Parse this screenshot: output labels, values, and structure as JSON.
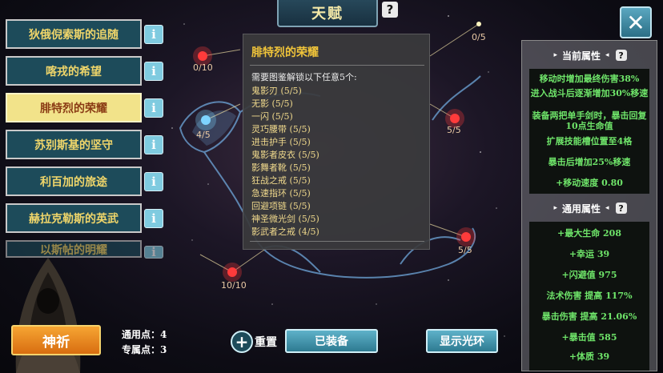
{
  "header": {
    "title": "天赋"
  },
  "talent_list": [
    {
      "label": "狄俄倪索斯的追随",
      "selected": false
    },
    {
      "label": "喀戎的希望",
      "selected": false
    },
    {
      "label": "腓特烈的荣耀",
      "selected": true
    },
    {
      "label": "苏别斯基的坚守",
      "selected": false
    },
    {
      "label": "利百加的旅途",
      "selected": false
    },
    {
      "label": "赫拉克勒斯的英武",
      "selected": false
    },
    {
      "label": "以斯帖的明耀",
      "selected": false
    }
  ],
  "info_glyph": "i",
  "tooltip": {
    "title": "腓特烈的荣耀",
    "desc": "需要图鉴解锁以下任意5个:",
    "requirements": [
      "鬼影刃 (5/5)",
      "无影 (5/5)",
      "一闪 (5/5)",
      "灵巧腰带 (5/5)",
      "进击护手 (5/5)",
      "鬼影者皮衣 (5/5)",
      "影舞者靴 (5/5)",
      "狂战之戒 (5/5)",
      "急速指环 (5/5)",
      "回避项链 (5/5)",
      "神圣微光剑 (5/5)",
      "影武者之戒 (4/5)"
    ]
  },
  "nodes": [
    {
      "label": "0/5"
    },
    {
      "label": "0/10"
    },
    {
      "label": "4/5"
    },
    {
      "label": "5/5"
    },
    {
      "label": "5/5"
    },
    {
      "label": "10/10"
    }
  ],
  "current_attrs": {
    "heading": "当前属性",
    "items": [
      "移动时增加最终伤害38%",
      "进入战斗后逐渐增加30%移速",
      "装备两把单手剑时，暴击回复10点生命值",
      "扩展技能槽位置至4格",
      "暴击后增加25%移速",
      "+移动速度 0.80"
    ]
  },
  "general_attrs": {
    "heading": "通用属性",
    "items": [
      "+最大生命 208",
      "+幸运 39",
      "+闪避值 975",
      "法术伤害 提高 117%",
      "暴击伤害 提高 21.06%",
      "+暴击值 585",
      "+体质 39"
    ]
  },
  "help_glyph": "?",
  "close_glyph": "✕",
  "bottom": {
    "pray_label": "神祈",
    "general_points_label": "通用点：",
    "general_points": "4",
    "special_points_label": "专属点：",
    "special_points": "3",
    "reset_label": "重置",
    "equipped_label": "已装备",
    "show_halo_label": "显示光环"
  },
  "colors": {
    "accent": "#f0d66a",
    "panel": "#1d4b5a",
    "stat_green": "#6fe56a",
    "tooltip_title": "#f0c43a"
  }
}
